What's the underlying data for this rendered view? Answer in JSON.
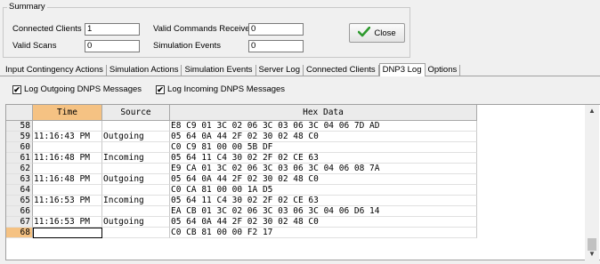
{
  "summary": {
    "legend": "Summary",
    "connected_clients_label": "Connected Clients",
    "connected_clients_value": "1",
    "valid_scans_label": "Valid Scans",
    "valid_scans_value": "0",
    "valid_commands_label": "Valid Commands Received",
    "valid_commands_value": "0",
    "simulation_events_label": "Simulation Events",
    "simulation_events_value": "0",
    "close_label": "Close"
  },
  "tabs": [
    {
      "label": "Input Contingency Actions"
    },
    {
      "label": "Simulation Actions"
    },
    {
      "label": "Simulation Events"
    },
    {
      "label": "Server Log"
    },
    {
      "label": "Connected Clients"
    },
    {
      "label": "DNP3 Log",
      "active": true
    },
    {
      "label": "Options"
    }
  ],
  "checks": {
    "log_outgoing": "Log Outgoing DNPS Messages",
    "log_incoming": "Log Incoming DNPS Messages",
    "checkmark": "✔"
  },
  "grid": {
    "headers": {
      "time": "Time",
      "source": "Source",
      "hex": "Hex Data"
    },
    "rows": [
      {
        "num": "58",
        "time": "",
        "source": "",
        "hex": "E8 C9 01 3C 02 06 3C 03 06 3C 04 06 7D AD"
      },
      {
        "num": "59",
        "time": "11:16:43 PM",
        "source": "Outgoing",
        "hex": "05 64 0A 44 2F 02 30 02 48 C0"
      },
      {
        "num": "60",
        "time": "",
        "source": "",
        "hex": "C0 C9 81 00 00 5B DF"
      },
      {
        "num": "61",
        "time": "11:16:48 PM",
        "source": "Incoming",
        "hex": "05 64 11 C4 30 02 2F 02 CE 63"
      },
      {
        "num": "62",
        "time": "",
        "source": "",
        "hex": "E9 CA 01 3C 02 06 3C 03 06 3C 04 06 08 7A"
      },
      {
        "num": "63",
        "time": "11:16:48 PM",
        "source": "Outgoing",
        "hex": "05 64 0A 44 2F 02 30 02 48 C0"
      },
      {
        "num": "64",
        "time": "",
        "source": "",
        "hex": "C0 CA 81 00 00 1A D5"
      },
      {
        "num": "65",
        "time": "11:16:53 PM",
        "source": "Incoming",
        "hex": "05 64 11 C4 30 02 2F 02 CE 63"
      },
      {
        "num": "66",
        "time": "",
        "source": "",
        "hex": "EA CB 01 3C 02 06 3C 03 06 3C 04 06 D6 14"
      },
      {
        "num": "67",
        "time": "11:16:53 PM",
        "source": "Outgoing",
        "hex": "05 64 0A 44 2F 02 30 02 48 C0"
      },
      {
        "num": "68",
        "time": "",
        "source": "",
        "hex": "C0 CB 81 00 00 F2 17"
      }
    ]
  },
  "scroll": {
    "up": "▲",
    "down": "▼"
  },
  "colors": {
    "selected_header": "#f5c283",
    "check_green": "#2e9a2e"
  }
}
